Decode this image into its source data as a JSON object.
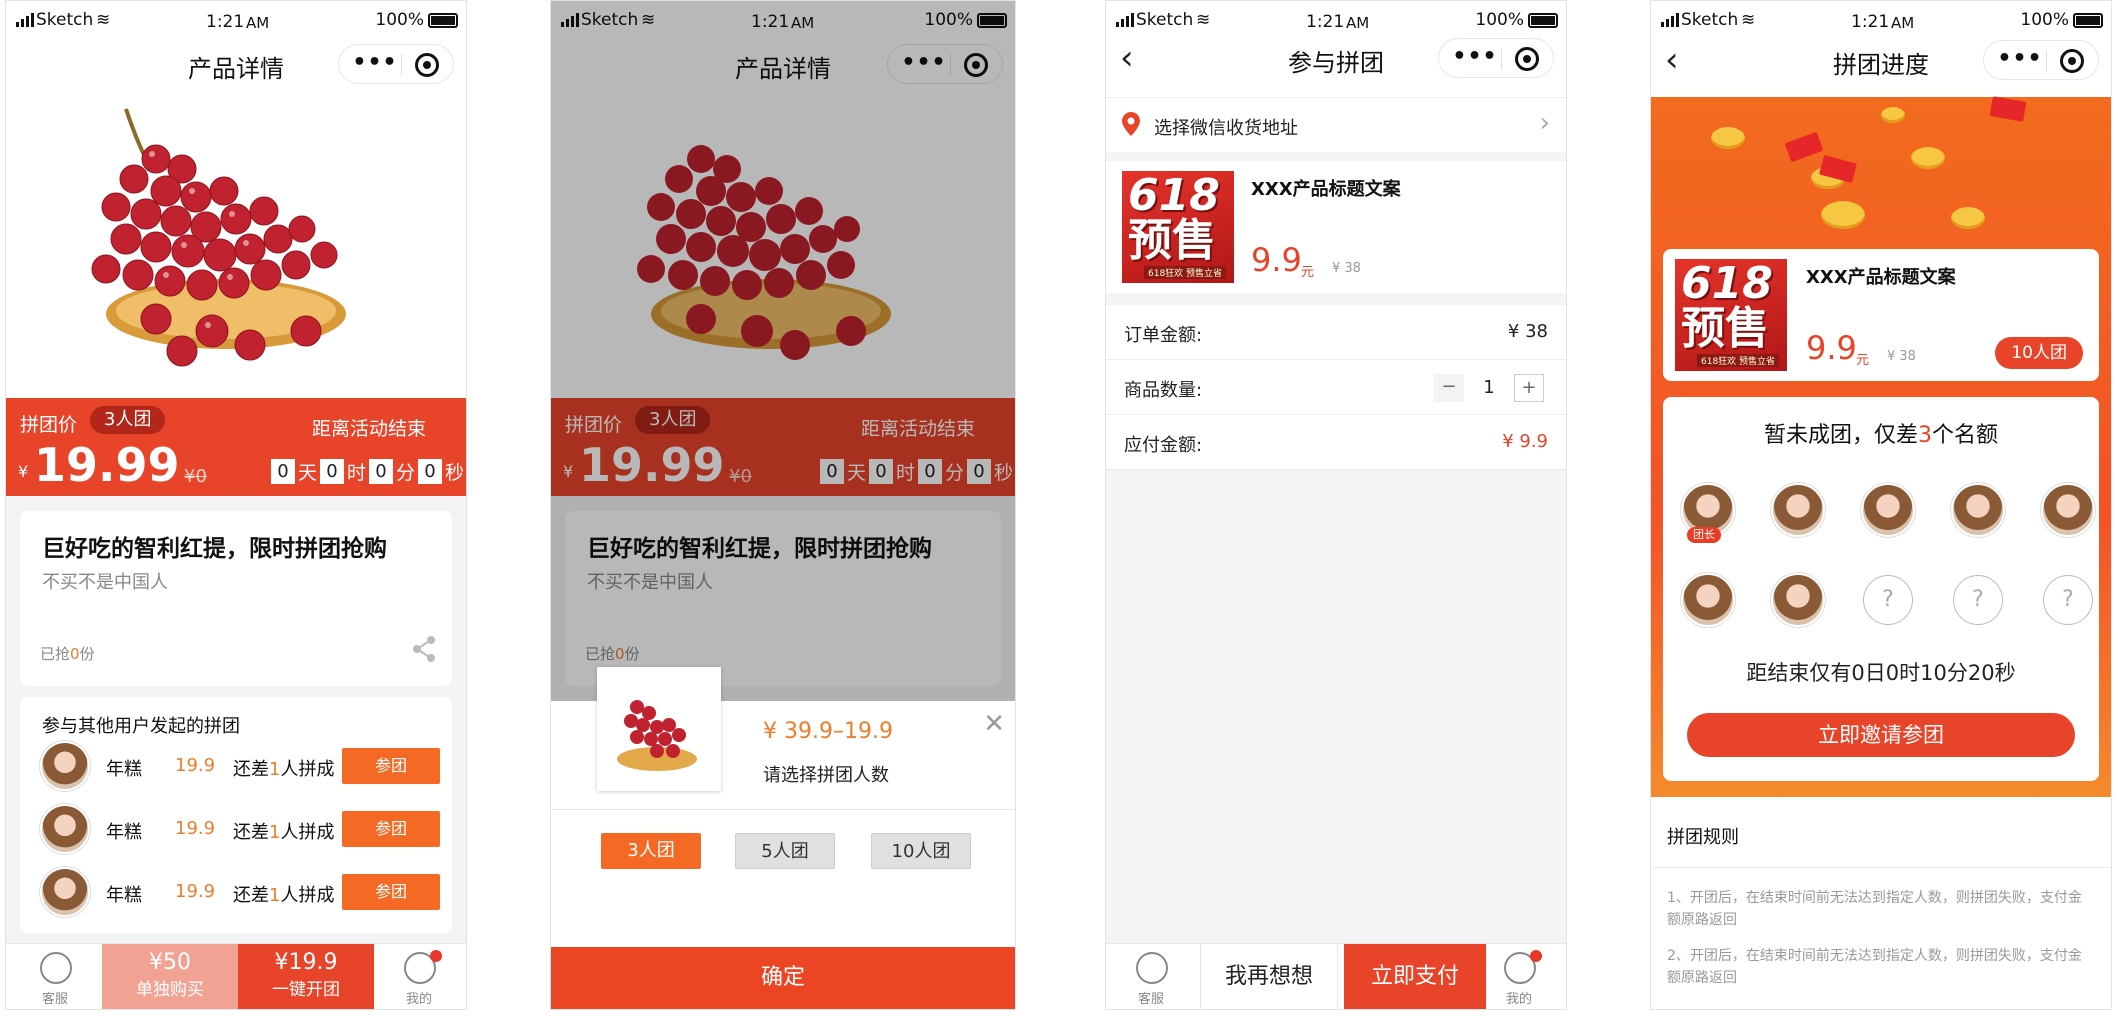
{
  "status": {
    "carrier": "Sketch",
    "time": "1:21",
    "ampm": "AM",
    "battery": "100%"
  },
  "screen1": {
    "title": "产品详情",
    "group_label": "拼团价",
    "group_tag": "3人团",
    "currency": "¥",
    "price": "19.99",
    "orig_price": "¥0",
    "end_label": "距离活动结束",
    "countdown": {
      "days": "0",
      "day_unit": "天",
      "hours": "0",
      "hour_unit": "时",
      "minutes": "0",
      "minute_unit": "分",
      "seconds": "0",
      "second_unit": "秒"
    },
    "product_title": "巨好吃的智利红提，限时拼团抢购",
    "product_sub": "不买不是中国人",
    "sold_prefix": "已抢",
    "sold_count": "0",
    "sold_suffix": "份",
    "groups_title": "参与其他用户发起的拼团",
    "groups": [
      {
        "name": "年糕",
        "price": "19.9",
        "need_pre": "还差",
        "need": "1",
        "need_post": "人拼成",
        "button": "参团"
      },
      {
        "name": "年糕",
        "price": "19.9",
        "need_pre": "还差",
        "need": "1",
        "need_post": "人拼成",
        "button": "参团"
      },
      {
        "name": "年糕",
        "price": "19.9",
        "need_pre": "还差",
        "need": "1",
        "need_post": "人拼成",
        "button": "参团"
      }
    ],
    "tabbar": {
      "service": "客服",
      "single_price": "¥50",
      "single_label": "单独购买",
      "group_price": "¥19.9",
      "group_label": "一键开团",
      "mine": "我的"
    }
  },
  "screen2": {
    "sheet_price": "¥ 39.9–19.9",
    "sheet_prompt": "请选择拼团人数",
    "options": [
      "3人团",
      "5人团",
      "10人团"
    ],
    "confirm": "确定"
  },
  "screen3": {
    "title": "参与拼团",
    "address": "选择微信收货地址",
    "product_name": "XXX产品标题文案",
    "price": "9.9",
    "price_unit": "元",
    "orig": "¥ 38",
    "poster_top": "618",
    "poster_bottom": "预售",
    "poster_note": "618狂欢 预售立省",
    "order_label": "订单金额:",
    "order_value": "¥ 38",
    "qty_label": "商品数量:",
    "qty_minus": "−",
    "qty_value": "1",
    "qty_plus": "+",
    "pay_label": "应付金额:",
    "pay_value": "¥ 9.9",
    "tabbar": {
      "service": "客服",
      "think": "我再想想",
      "pay": "立即支付",
      "mine": "我的"
    }
  },
  "screen4": {
    "title": "拼团进度",
    "product_name": "XXX产品标题文案",
    "price": "9.9",
    "price_unit": "元",
    "orig": "¥ 38",
    "team_tag": "10人团",
    "status_pre": "暂未成团，仅差",
    "status_num": "3",
    "status_post": "个名额",
    "leader": "团长",
    "unknown": "?",
    "countdown": "距结束仅有0日0时10分20秒",
    "invite": "立即邀请参团",
    "rules_title": "拼团规则",
    "rules": [
      "1、开团后，在结束时间前无法达到指定人数，则拼团失败，支付金额原路返回",
      "2、开团后，在结束时间前无法达到指定人数，则拼团失败，支付金额原路返回"
    ]
  },
  "colors": {
    "brand": "#e8442a",
    "accent": "#f07c2a",
    "button": "#f46a24"
  }
}
